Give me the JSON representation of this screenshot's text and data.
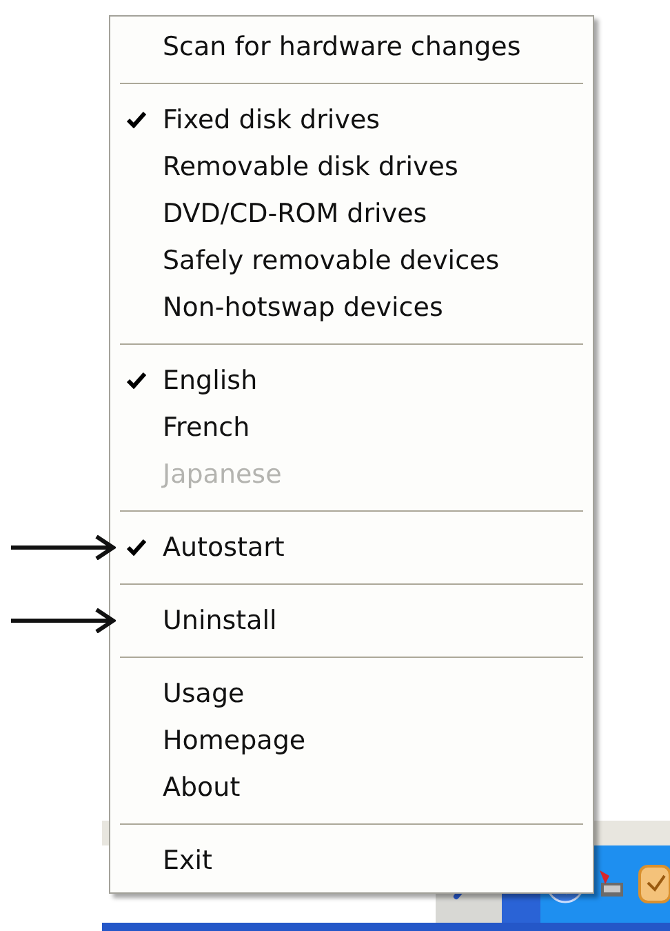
{
  "menu": {
    "groups": [
      [
        {
          "label": "Scan for hardware changes",
          "checked": false,
          "disabled": false,
          "pointed": false
        }
      ],
      [
        {
          "label": "Fixed disk drives",
          "checked": true,
          "disabled": false,
          "pointed": false
        },
        {
          "label": "Removable disk drives",
          "checked": false,
          "disabled": false,
          "pointed": false
        },
        {
          "label": "DVD/CD-ROM drives",
          "checked": false,
          "disabled": false,
          "pointed": false
        },
        {
          "label": "Safely removable devices",
          "checked": false,
          "disabled": false,
          "pointed": false
        },
        {
          "label": "Non-hotswap devices",
          "checked": false,
          "disabled": false,
          "pointed": false
        }
      ],
      [
        {
          "label": "English",
          "checked": true,
          "disabled": false,
          "pointed": false
        },
        {
          "label": "French",
          "checked": false,
          "disabled": false,
          "pointed": false
        },
        {
          "label": "Japanese",
          "checked": false,
          "disabled": true,
          "pointed": false
        }
      ],
      [
        {
          "label": "Autostart",
          "checked": true,
          "disabled": false,
          "pointed": true
        }
      ],
      [
        {
          "label": "Uninstall",
          "checked": false,
          "disabled": false,
          "pointed": true
        }
      ],
      [
        {
          "label": "Usage",
          "checked": false,
          "disabled": false,
          "pointed": false
        },
        {
          "label": "Homepage",
          "checked": false,
          "disabled": false,
          "pointed": false
        },
        {
          "label": "About",
          "checked": false,
          "disabled": false,
          "pointed": false
        }
      ],
      [
        {
          "label": "Exit",
          "checked": false,
          "disabled": false,
          "pointed": false
        }
      ]
    ]
  }
}
